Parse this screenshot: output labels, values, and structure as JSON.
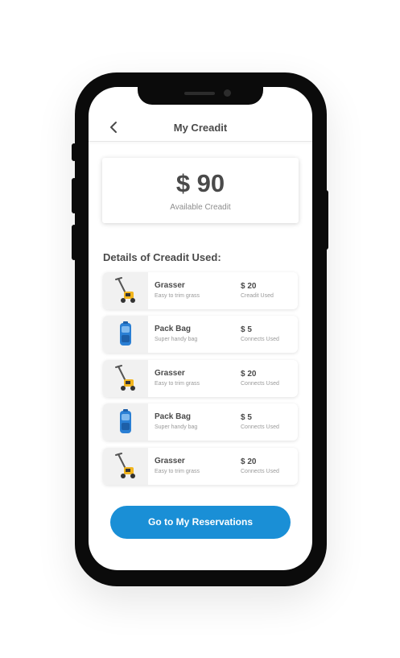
{
  "header": {
    "title": "My Creadit"
  },
  "credit": {
    "amount": "$ 90",
    "label": "Available Creadit"
  },
  "section_title": "Details of Creadit Used:",
  "items": [
    {
      "name": "Grasser",
      "desc": "Easy to trim grass",
      "price": "$ 20",
      "used_label": "Creadit Used",
      "icon": "grass-trimmer-icon"
    },
    {
      "name": "Pack Bag",
      "desc": "Super handy bag",
      "price": "$ 5",
      "used_label": "Connects Used",
      "icon": "pack-bag-icon"
    },
    {
      "name": "Grasser",
      "desc": "Easy to trim grass",
      "price": "$ 20",
      "used_label": "Connects Used",
      "icon": "grass-trimmer-icon"
    },
    {
      "name": "Pack Bag",
      "desc": "Super handy bag",
      "price": "$ 5",
      "used_label": "Connects Used",
      "icon": "pack-bag-icon"
    },
    {
      "name": "Grasser",
      "desc": "Easy to trim grass",
      "price": "$ 20",
      "used_label": "Connects Used",
      "icon": "grass-trimmer-icon"
    }
  ],
  "cta": {
    "label": "Go to My Reservations"
  },
  "colors": {
    "accent": "#1a8fd6",
    "phone_frame": "#0b0b0b",
    "text": "#4a4a4a"
  }
}
